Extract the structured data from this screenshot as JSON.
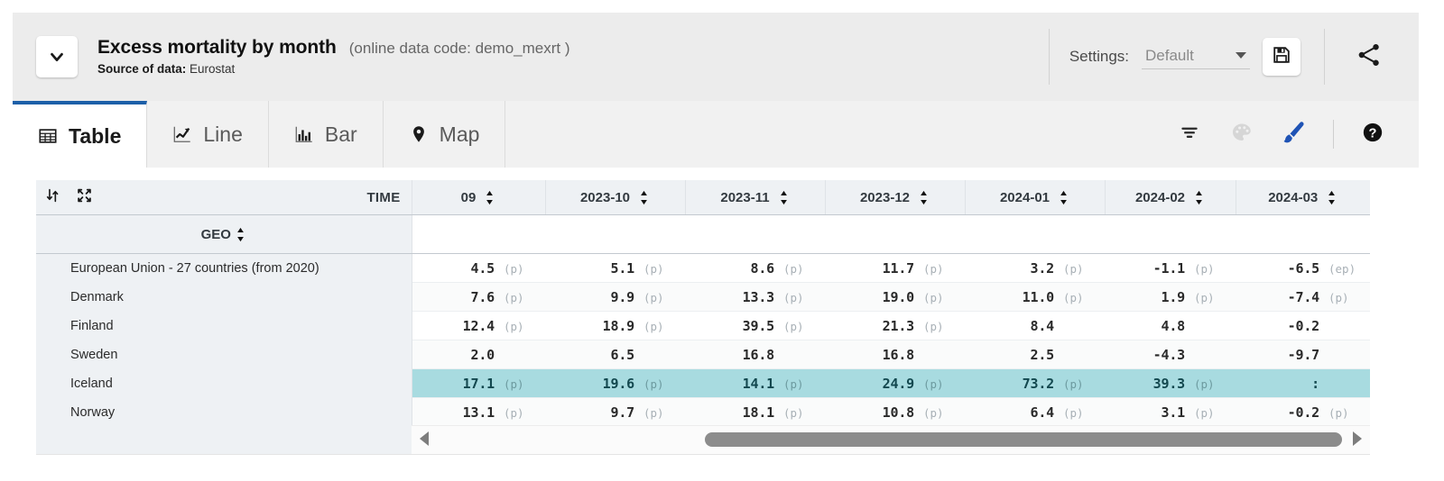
{
  "header": {
    "collapse_icon": "chevron-down-icon",
    "dataset_title": "Excess mortality by month",
    "dataset_code": "(online data code: demo_mexrt )",
    "source_label": "Source of data:",
    "source_value": "Eurostat",
    "settings_label": "Settings:",
    "settings_value": "Default",
    "save_icon": "floppy-disk-icon",
    "share_icon": "share-icon"
  },
  "tabs": [
    {
      "label": "Table",
      "icon": "table-grid-icon",
      "active": true
    },
    {
      "label": "Line",
      "icon": "line-chart-icon",
      "active": false
    },
    {
      "label": "Bar",
      "icon": "bar-chart-icon",
      "active": false
    },
    {
      "label": "Map",
      "icon": "map-pin-icon",
      "active": false
    }
  ],
  "tab_tools": [
    {
      "name": "filter-icon",
      "state": "enabled"
    },
    {
      "name": "palette-icon",
      "state": "disabled"
    },
    {
      "name": "brush-icon",
      "state": "active"
    },
    {
      "name": "help-icon",
      "state": "enabled"
    }
  ],
  "table": {
    "sort_icon": "sort-updown-icon",
    "expand_icon": "expand-arrows-icon",
    "time_label": "TIME",
    "geo_label": "GEO",
    "columns": [
      "09",
      "2023-10",
      "2023-11",
      "2023-12",
      "2024-01",
      "2024-02",
      "2024-03"
    ],
    "rows": [
      {
        "geo": "European Union - 27 countries (from 2020)",
        "highlight": false,
        "cells": [
          {
            "value": "4.5",
            "flag": "(p)"
          },
          {
            "value": "5.1",
            "flag": "(p)"
          },
          {
            "value": "8.6",
            "flag": "(p)"
          },
          {
            "value": "11.7",
            "flag": "(p)"
          },
          {
            "value": "3.2",
            "flag": "(p)"
          },
          {
            "value": "-1.1",
            "flag": "(p)"
          },
          {
            "value": "-6.5",
            "flag": "(ep)"
          }
        ]
      },
      {
        "geo": "Denmark",
        "highlight": false,
        "cells": [
          {
            "value": "7.6",
            "flag": "(p)"
          },
          {
            "value": "9.9",
            "flag": "(p)"
          },
          {
            "value": "13.3",
            "flag": "(p)"
          },
          {
            "value": "19.0",
            "flag": "(p)"
          },
          {
            "value": "11.0",
            "flag": "(p)"
          },
          {
            "value": "1.9",
            "flag": "(p)"
          },
          {
            "value": "-7.4",
            "flag": "(p)"
          }
        ]
      },
      {
        "geo": "Finland",
        "highlight": false,
        "cells": [
          {
            "value": "12.4",
            "flag": "(p)"
          },
          {
            "value": "18.9",
            "flag": "(p)"
          },
          {
            "value": "39.5",
            "flag": "(p)"
          },
          {
            "value": "21.3",
            "flag": "(p)"
          },
          {
            "value": "8.4",
            "flag": ""
          },
          {
            "value": "4.8",
            "flag": ""
          },
          {
            "value": "-0.2",
            "flag": ""
          }
        ]
      },
      {
        "geo": "Sweden",
        "highlight": false,
        "cells": [
          {
            "value": "2.0",
            "flag": ""
          },
          {
            "value": "6.5",
            "flag": ""
          },
          {
            "value": "16.8",
            "flag": ""
          },
          {
            "value": "16.8",
            "flag": ""
          },
          {
            "value": "2.5",
            "flag": ""
          },
          {
            "value": "-4.3",
            "flag": ""
          },
          {
            "value": "-9.7",
            "flag": ""
          }
        ]
      },
      {
        "geo": "Iceland",
        "highlight": true,
        "cells": [
          {
            "value": "17.1",
            "flag": "(p)"
          },
          {
            "value": "19.6",
            "flag": "(p)"
          },
          {
            "value": "14.1",
            "flag": "(p)"
          },
          {
            "value": "24.9",
            "flag": "(p)"
          },
          {
            "value": "73.2",
            "flag": "(p)"
          },
          {
            "value": "39.3",
            "flag": "(p)"
          },
          {
            "value": ":",
            "flag": ""
          }
        ]
      },
      {
        "geo": "Norway",
        "highlight": false,
        "cells": [
          {
            "value": "13.1",
            "flag": "(p)"
          },
          {
            "value": "9.7",
            "flag": "(p)"
          },
          {
            "value": "18.1",
            "flag": "(p)"
          },
          {
            "value": "10.8",
            "flag": "(p)"
          },
          {
            "value": "6.4",
            "flag": "(p)"
          },
          {
            "value": "3.1",
            "flag": "(p)"
          },
          {
            "value": "-0.2",
            "flag": "(p)"
          }
        ]
      }
    ]
  },
  "scrollbar": {
    "left_arrow_icon": "triangle-left-icon",
    "right_arrow_icon": "triangle-right-icon"
  },
  "colors": {
    "accent_blue": "#1c5fa8",
    "highlight_row": "#a8dbe0",
    "header_panel": "#ececec",
    "tabbar": "#f1f1f1",
    "table_header": "#eef1f4"
  }
}
